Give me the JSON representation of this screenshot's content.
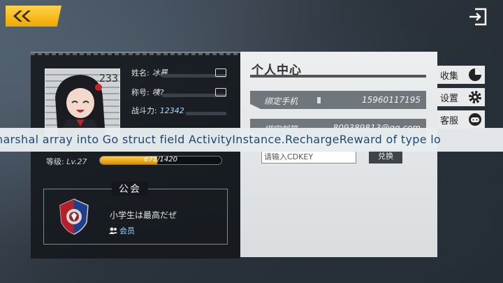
{
  "profile": {
    "name_label": "姓名:",
    "name_value": "冰暴",
    "title_label": "称号:",
    "title_value": "咦?",
    "power_label": "战斗力:",
    "power_value": "12342",
    "avatar_number": "233",
    "level_label": "等级:",
    "level_value": "Lv.27",
    "xp_text": "671/1420",
    "xp_current": 671,
    "xp_max": 1420
  },
  "guild": {
    "title": "公会",
    "name": "小学生は最高だぜ",
    "role": "会员"
  },
  "personal_center": {
    "title": "个人中心",
    "phone_label": "绑定手机",
    "phone_value": "15960117195",
    "email_label": "绑定邮箱",
    "email_value": "809389813@qq.com",
    "cdkey_placeholder": "请输入CDKEY",
    "redeem_button": "兑换"
  },
  "side_tabs": [
    {
      "label": "收集",
      "icon": "pie-chart-icon"
    },
    {
      "label": "设置",
      "icon": "gear-icon"
    },
    {
      "label": "客服",
      "icon": "headset-icon"
    }
  ],
  "error_message": "narshal array into Go struct field ActivityInstance.RechargeReward of type lo",
  "colors": {
    "accent_yellow": "#f5b400",
    "power_blue": "#a6dcf6",
    "role_blue": "#9fd8ff",
    "error_text": "#1f4870"
  }
}
